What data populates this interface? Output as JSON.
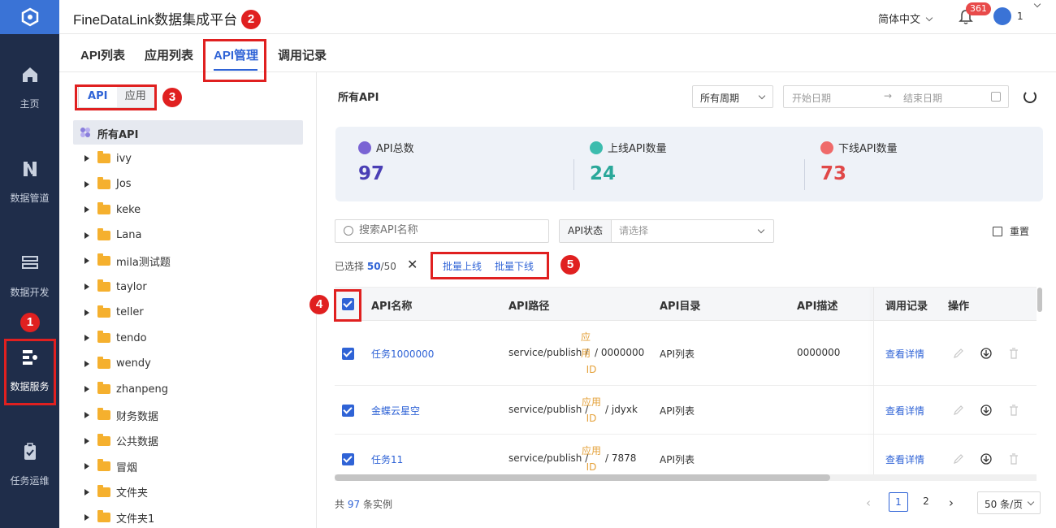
{
  "app": {
    "title": "FineDataLink数据集成平台"
  },
  "header": {
    "language": "简体中文",
    "notif_count": "361",
    "user": "1"
  },
  "nav": [
    {
      "label": "主页",
      "icon": "home-icon"
    },
    {
      "label": "数据管道",
      "icon": "pipeline-icon"
    },
    {
      "label": "数据开发",
      "icon": "develop-icon"
    },
    {
      "label": "数据服务",
      "icon": "data-service-icon",
      "active": true
    },
    {
      "label": "任务运维",
      "icon": "clipboard-icon"
    }
  ],
  "tabs": [
    "API列表",
    "应用列表",
    "API管理",
    "调用记录"
  ],
  "tree": {
    "seg_api": "API",
    "seg_app": "应用",
    "all_label": "所有API",
    "folders": [
      "ivy",
      "Jos",
      "keke",
      "Lana",
      "mila测试题",
      "taylor",
      "teller",
      "tendo",
      "wendy",
      "zhanpeng",
      "财务数据",
      "公共数据",
      "冒烟",
      "文件夹",
      "文件夹1"
    ]
  },
  "main": {
    "title": "所有API",
    "period": "所有周期",
    "start_placeholder": "开始日期",
    "end_placeholder": "结束日期",
    "stats": [
      {
        "label": "API总数",
        "value": "97",
        "color": "#4a3fb5"
      },
      {
        "label": "上线API数量",
        "value": "24",
        "color": "#2aa89a"
      },
      {
        "label": "下线API数量",
        "value": "73",
        "color": "#e04848"
      }
    ],
    "search_placeholder": "搜索API名称",
    "status_label": "API状态",
    "status_placeholder": "请选择",
    "reset": "重置",
    "selected_prefix": "已选择",
    "selected_count": "50",
    "selected_total": "/50",
    "batch_online": "批量上线",
    "batch_offline": "批量下线"
  },
  "table": {
    "headers": [
      "API名称",
      "API路径",
      "API目录",
      "API描述",
      "调用记录",
      "操作"
    ],
    "rows": [
      {
        "name": "任务1000000",
        "path_prefix": "service/publish",
        "path_mid": [
          "应",
          "用",
          "ID"
        ],
        "path_suffix": "0000000",
        "dir": "API列表",
        "desc": "0000000",
        "record": "查看详情"
      },
      {
        "name": "金蝶云星空",
        "path_prefix": "service/publish",
        "path_mid": [
          "应用",
          "ID"
        ],
        "path_suffix": "jdyxk",
        "dir": "API列表",
        "desc": "",
        "record": "查看详情"
      },
      {
        "name": "任务11",
        "path_prefix": "service/publish",
        "path_mid": [
          "应用",
          "ID"
        ],
        "path_suffix": "7878",
        "dir": "API列表",
        "desc": "",
        "record": "查看详情"
      }
    ]
  },
  "footer": {
    "total_prefix": "共",
    "total": "97",
    "total_suffix": "条实例",
    "pages": [
      "1",
      "2"
    ],
    "page_size": "50 条/页"
  },
  "annotations": [
    "1",
    "2",
    "3",
    "4",
    "5"
  ],
  "colors": {
    "accent": "#2f63d6",
    "nav_bg": "#1f2d4a",
    "annotation": "#e02020",
    "folder": "#f5b02e"
  }
}
